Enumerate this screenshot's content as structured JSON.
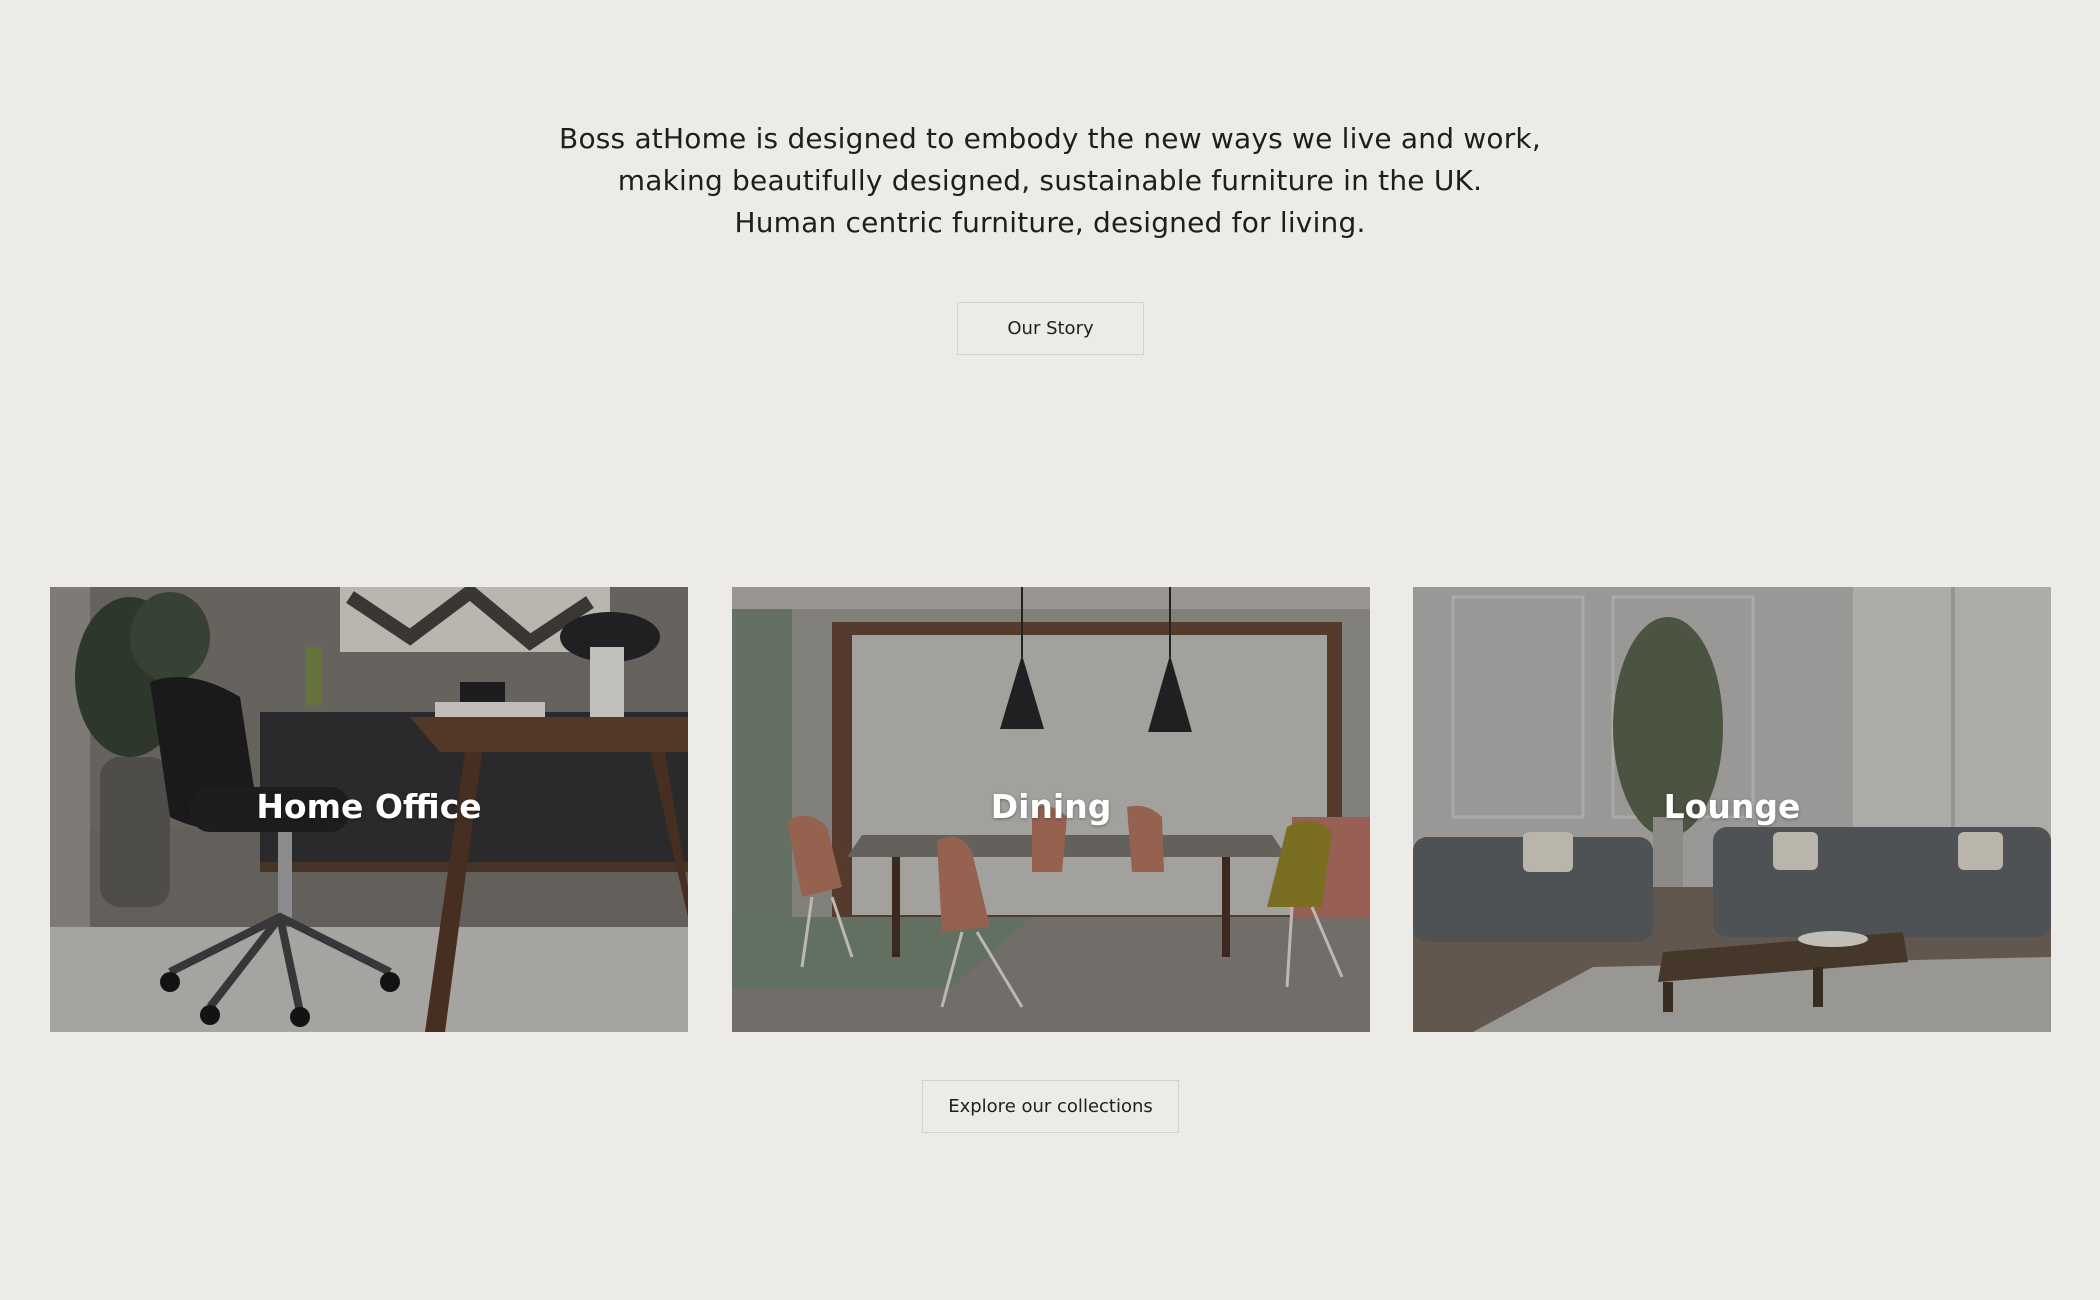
{
  "intro": {
    "lines": [
      "Boss atHome is designed to embody the new ways we live and work,",
      "making beautifully designed, sustainable furniture in the UK.",
      "Human centric furniture, designed for living."
    ],
    "story_button": "Our Story"
  },
  "collections": {
    "cards": [
      {
        "label": "Home Office",
        "image": "home-office-photo"
      },
      {
        "label": "Dining",
        "image": "dining-room-photo"
      },
      {
        "label": "Lounge",
        "image": "lounge-photo"
      }
    ],
    "explore_button": "Explore our collections"
  },
  "colors": {
    "background": "#ecebe7",
    "text": "#1e1e1e",
    "button_border": "#d3d1cc",
    "card_label": "#ffffff"
  }
}
